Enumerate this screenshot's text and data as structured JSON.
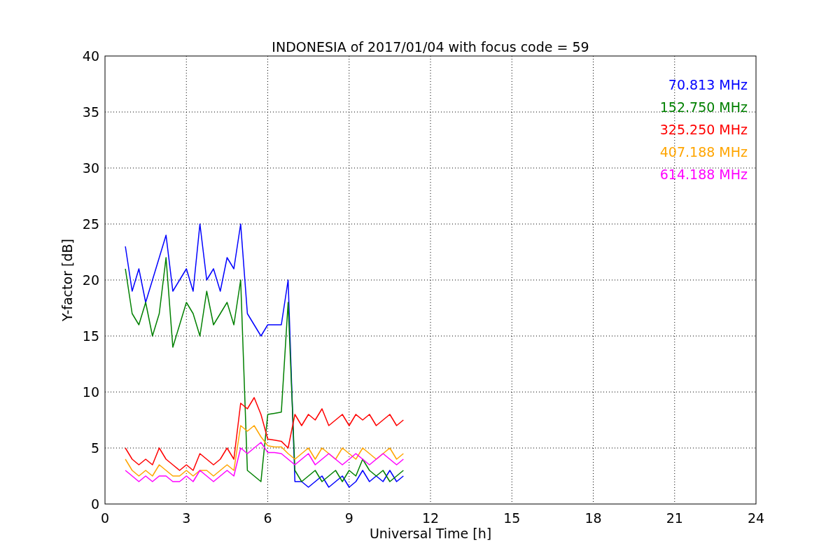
{
  "chart_data": {
    "type": "line",
    "title": "INDONESIA of 2017/01/04 with focus code = 59",
    "xlabel": "Universal Time [h]",
    "ylabel": "Y-factor [dB]",
    "xlim": [
      0,
      24
    ],
    "ylim": [
      0,
      40
    ],
    "xticks": [
      0,
      3,
      6,
      9,
      12,
      15,
      18,
      21,
      24
    ],
    "yticks": [
      0,
      5,
      10,
      15,
      20,
      25,
      30,
      35,
      40
    ],
    "grid": true,
    "x": [
      0.75,
      1,
      1.25,
      1.5,
      1.75,
      2,
      2.25,
      2.5,
      2.75,
      3,
      3.25,
      3.5,
      3.75,
      4,
      4.25,
      4.5,
      4.75,
      5,
      5.25,
      5.5,
      5.75,
      6,
      6.25,
      6.5,
      6.75,
      7,
      7.25,
      7.5,
      7.75,
      8,
      8.25,
      8.5,
      8.75,
      9,
      9.25,
      9.5,
      9.75,
      10,
      10.25,
      10.5,
      10.75,
      11
    ],
    "series": [
      {
        "name": "70.813 MHz",
        "color": "#0000ff",
        "values": [
          23,
          19,
          21,
          18,
          20,
          22,
          24,
          19,
          20,
          21,
          19,
          25,
          20,
          21,
          19,
          22,
          21,
          25,
          17,
          16,
          15,
          16,
          16,
          16,
          20,
          2,
          2,
          1.5,
          2,
          2.5,
          1.5,
          2,
          2.5,
          1.5,
          2,
          3,
          2,
          2.5,
          2,
          3,
          2,
          2.5
        ]
      },
      {
        "name": "152.750 MHz",
        "color": "#008000",
        "values": [
          21,
          17,
          16,
          18,
          15,
          17,
          22,
          14,
          16,
          18,
          17,
          15,
          19,
          16,
          17,
          18,
          16,
          20,
          3,
          2.5,
          2,
          8,
          8.1,
          8.2,
          18,
          3,
          2,
          2.5,
          3,
          2,
          2.5,
          3,
          2,
          3,
          2.5,
          4,
          3,
          2.5,
          3,
          2,
          2.5,
          3
        ]
      },
      {
        "name": "325.250 MHz",
        "color": "#ff0000",
        "values": [
          5,
          4,
          3.5,
          4,
          3.5,
          5,
          4,
          3.5,
          3,
          3.5,
          3,
          4.5,
          4,
          3.5,
          4,
          5,
          4,
          9,
          8.5,
          9.5,
          8,
          5.8,
          5.7,
          5.6,
          5,
          8,
          7,
          8,
          7.5,
          8.5,
          7,
          7.5,
          8,
          7,
          8,
          7.5,
          8,
          7,
          7.5,
          8,
          7,
          7.5
        ]
      },
      {
        "name": "407.188 MHz",
        "color": "#ffa500",
        "values": [
          4,
          3,
          2.5,
          3,
          2.5,
          3.5,
          3,
          2.5,
          2.5,
          3,
          2.5,
          3,
          3,
          2.5,
          3,
          3.5,
          3,
          7,
          6.5,
          7,
          6,
          5.2,
          5.1,
          5.1,
          4.5,
          4,
          4.5,
          5,
          4,
          5,
          4.5,
          4,
          5,
          4.5,
          4,
          5,
          4.5,
          4,
          4.5,
          5,
          4,
          4.5
        ]
      },
      {
        "name": "614.188 MHz",
        "color": "#ff00ff",
        "values": [
          3,
          2.5,
          2,
          2.5,
          2,
          2.5,
          2.5,
          2,
          2,
          2.5,
          2,
          3,
          2.5,
          2,
          2.5,
          3,
          2.5,
          5,
          4.5,
          5,
          5.5,
          4.6,
          4.6,
          4.5,
          4,
          3.5,
          4,
          4.5,
          3.5,
          4,
          4.5,
          4,
          3.5,
          4,
          4.5,
          4,
          3.5,
          4,
          4.5,
          4,
          3.5,
          4
        ]
      }
    ]
  }
}
